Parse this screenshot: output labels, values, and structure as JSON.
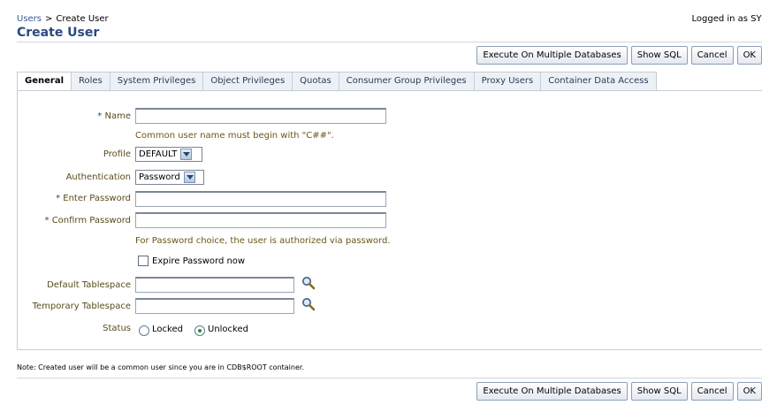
{
  "breadcrumb": {
    "parent": "Users",
    "separator": ">",
    "current": "Create User"
  },
  "page_title": "Create User",
  "logged_in": "Logged in as SYS",
  "buttons": {
    "execute_multiple": "Execute On Multiple Databases",
    "show_sql": "Show SQL",
    "cancel": "Cancel",
    "ok": "OK"
  },
  "tabs": [
    {
      "label": "General",
      "active": true
    },
    {
      "label": "Roles"
    },
    {
      "label": "System Privileges"
    },
    {
      "label": "Object Privileges"
    },
    {
      "label": "Quotas"
    },
    {
      "label": "Consumer Group Privileges"
    },
    {
      "label": "Proxy Users"
    },
    {
      "label": "Container Data Access"
    }
  ],
  "form": {
    "required_marker": "*",
    "name_label": "Name",
    "name_value": "",
    "name_hint": "Common user name must begin with \"C##\".",
    "profile_label": "Profile",
    "profile_value": "DEFAULT",
    "authentication_label": "Authentication",
    "authentication_value": "Password",
    "enter_password_label": "Enter Password",
    "confirm_password_label": "Confirm Password",
    "password_hint": "For Password choice, the user is authorized via password.",
    "expire_password_label": "Expire Password now",
    "expire_password_checked": false,
    "default_tablespace_label": "Default Tablespace",
    "default_tablespace_value": "",
    "temporary_tablespace_label": "Temporary Tablespace",
    "temporary_tablespace_value": "",
    "status_label": "Status",
    "status_locked": "Locked",
    "status_unlocked": "Unlocked",
    "status_selected": "Unlocked"
  },
  "note": "Note: Created user will be a common user since you are in CDB$ROOT container.",
  "colors": {
    "title": "#2a4a7e",
    "label": "#5a4a1a",
    "hint": "#6b5714",
    "tab_bg": "#edf1f6"
  },
  "icons": {
    "search": "search-icon"
  }
}
